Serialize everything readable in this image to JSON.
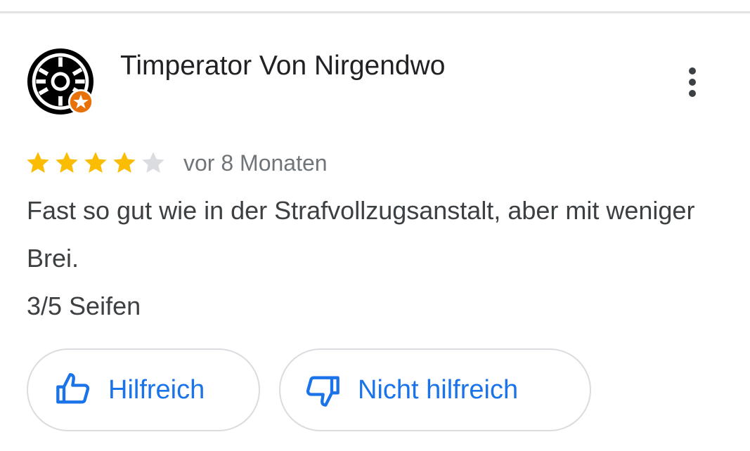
{
  "review": {
    "author": {
      "name": "Timperator Von Nirgendwo",
      "avatar_icon": "imperial-cog-icon",
      "badge_icon": "local-guide-star-icon"
    },
    "rating": 4,
    "max_rating": 5,
    "date": "vor 8 Monaten",
    "text_lines": [
      "Fast so gut wie in der Strafvollzugsanstalt, aber mit weniger Brei.",
      "3/5 Seifen"
    ]
  },
  "actions": {
    "helpful_label": "Hilfreich",
    "not_helpful_label": "Nicht hilfreich",
    "more_icon": "more-vert-icon"
  },
  "colors": {
    "star_filled": "#fbbc04",
    "star_empty": "#dadce0",
    "accent": "#1a73e8",
    "badge": "#e8710a"
  }
}
